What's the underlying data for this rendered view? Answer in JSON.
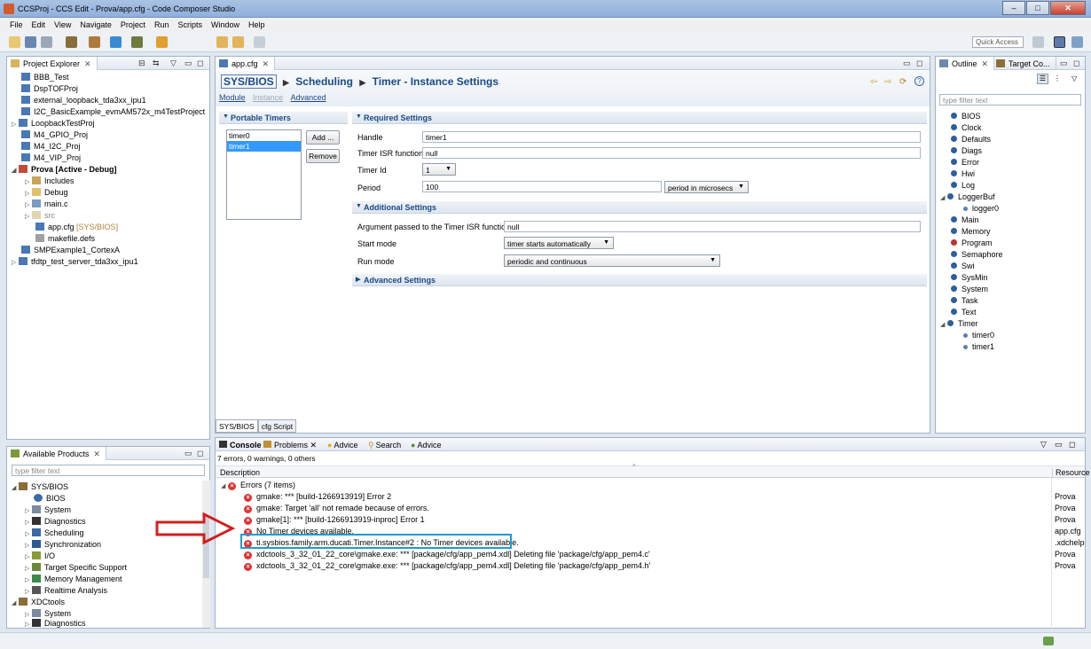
{
  "window": {
    "title": "CCSProj - CCS Edit - Prova/app.cfg - Code Composer Studio"
  },
  "menu": [
    "File",
    "Edit",
    "View",
    "Navigate",
    "Project",
    "Run",
    "Scripts",
    "Window",
    "Help"
  ],
  "toolbar": {
    "quick_access": "Quick Access"
  },
  "project_explorer": {
    "tab_label": "Project Explorer",
    "items": [
      {
        "label": "BBB_Test"
      },
      {
        "label": "DspTOFProj"
      },
      {
        "label": "external_loopback_tda3xx_ipu1"
      },
      {
        "label": "I2C_BasicExample_evmAM572x_m4TestProject"
      },
      {
        "label": "LoopbackTestProj"
      },
      {
        "label": "M4_GPIO_Proj"
      },
      {
        "label": "M4_I2C_Proj"
      },
      {
        "label": "M4_VIP_Proj"
      },
      {
        "label": "Prova  [Active - Debug]"
      },
      {
        "label": "Includes"
      },
      {
        "label": "Debug"
      },
      {
        "label": "main.c"
      },
      {
        "label": "src"
      },
      {
        "label": "app.cfg",
        "suffix": "[SYS/BIOS]"
      },
      {
        "label": "makefile.defs"
      },
      {
        "label": "SMPExample1_CortexA"
      },
      {
        "label": "tfdtp_test_server_tda3xx_ipu1"
      }
    ]
  },
  "available_products": {
    "tab_label": "Available Products",
    "filter_placeholder": "type filter text",
    "items": [
      {
        "label": "SYS/BIOS"
      },
      {
        "label": "BIOS"
      },
      {
        "label": "System"
      },
      {
        "label": "Diagnostics"
      },
      {
        "label": "Scheduling"
      },
      {
        "label": "Synchronization"
      },
      {
        "label": "I/O"
      },
      {
        "label": "Target Specific Support"
      },
      {
        "label": "Memory Management"
      },
      {
        "label": "Realtime Analysis"
      },
      {
        "label": "XDCtools"
      },
      {
        "label": "System"
      },
      {
        "label": "Diagnostics"
      }
    ]
  },
  "editor": {
    "tab_label": "app.cfg",
    "breadcrumb": [
      "SYS/BIOS",
      "Scheduling",
      "Timer - Instance Settings"
    ],
    "subnav": [
      "Module",
      "Instance",
      "Advanced"
    ],
    "portable_timers": {
      "title": "Portable Timers",
      "items": [
        "timer0",
        "timer1"
      ],
      "add": "Add ...",
      "remove": "Remove"
    },
    "required": {
      "title": "Required Settings",
      "handle_label": "Handle",
      "handle_value": "timer1",
      "isr_label": "Timer ISR function",
      "isr_value": "null",
      "timerid_label": "Timer Id",
      "timerid_value": "1",
      "period_label": "Period",
      "period_value": "100",
      "period_unit": "period in microsecs"
    },
    "additional": {
      "title": "Additional Settings",
      "arg_label": "Argument passed to the Timer ISR function",
      "arg_value": "null",
      "start_label": "Start mode",
      "start_value": "timer starts automatically",
      "run_label": "Run mode",
      "run_value": "periodic and continuous"
    },
    "advanced": {
      "title": "Advanced Settings"
    },
    "bottom_tabs": [
      "SYS/BIOS",
      "cfg Script"
    ]
  },
  "outline": {
    "tab_label": "Outline",
    "tab2_label": "Target Co...",
    "filter_placeholder": "type filter text",
    "items": [
      {
        "label": "BIOS"
      },
      {
        "label": "Clock"
      },
      {
        "label": "Defaults"
      },
      {
        "label": "Diags"
      },
      {
        "label": "Error"
      },
      {
        "label": "Hwi"
      },
      {
        "label": "Log"
      },
      {
        "label": "LoggerBuf"
      },
      {
        "label": "logger0"
      },
      {
        "label": "Main"
      },
      {
        "label": "Memory"
      },
      {
        "label": "Program"
      },
      {
        "label": "Semaphore"
      },
      {
        "label": "Swi"
      },
      {
        "label": "SysMin"
      },
      {
        "label": "System"
      },
      {
        "label": "Task"
      },
      {
        "label": "Text"
      },
      {
        "label": "Timer"
      },
      {
        "label": "timer0"
      },
      {
        "label": "timer1"
      }
    ]
  },
  "console": {
    "tabs": [
      "Console",
      "Problems",
      "Advice",
      "Search",
      "Advice"
    ],
    "summary": "7 errors, 0 warnings, 0 others",
    "col_description": "Description",
    "col_resource": "Resource",
    "group": "Errors (7 items)",
    "errors": [
      {
        "text": "gmake: *** [build-1266913919] Error 2",
        "resource": "Prova"
      },
      {
        "text": "gmake: Target 'all' not remade because of errors.",
        "resource": "Prova"
      },
      {
        "text": "gmake[1]: *** [build-1266913919-inproc] Error 1",
        "resource": "Prova"
      },
      {
        "text": "No Timer devices available.",
        "resource": "app.cfg"
      },
      {
        "text": "ti.sysbios.family.arm.ducati.Timer.Instance#2 : No Timer devices available.",
        "resource": ".xdchelp"
      },
      {
        "text": "xdctools_3_32_01_22_core\\gmake.exe: *** [package/cfg/app_pem4.xdl] Deleting file 'package/cfg/app_pem4.c'",
        "resource": "Prova"
      },
      {
        "text": "xdctools_3_32_01_22_core\\gmake.exe: *** [package/cfg/app_pem4.xdl] Deleting file 'package/cfg/app_pem4.h'",
        "resource": "Prova"
      }
    ]
  },
  "colors": {
    "accent": "#1a4a84",
    "error": "#d33333",
    "highlight_box": "#1f9bd1",
    "arrow": "#d11f1f"
  }
}
